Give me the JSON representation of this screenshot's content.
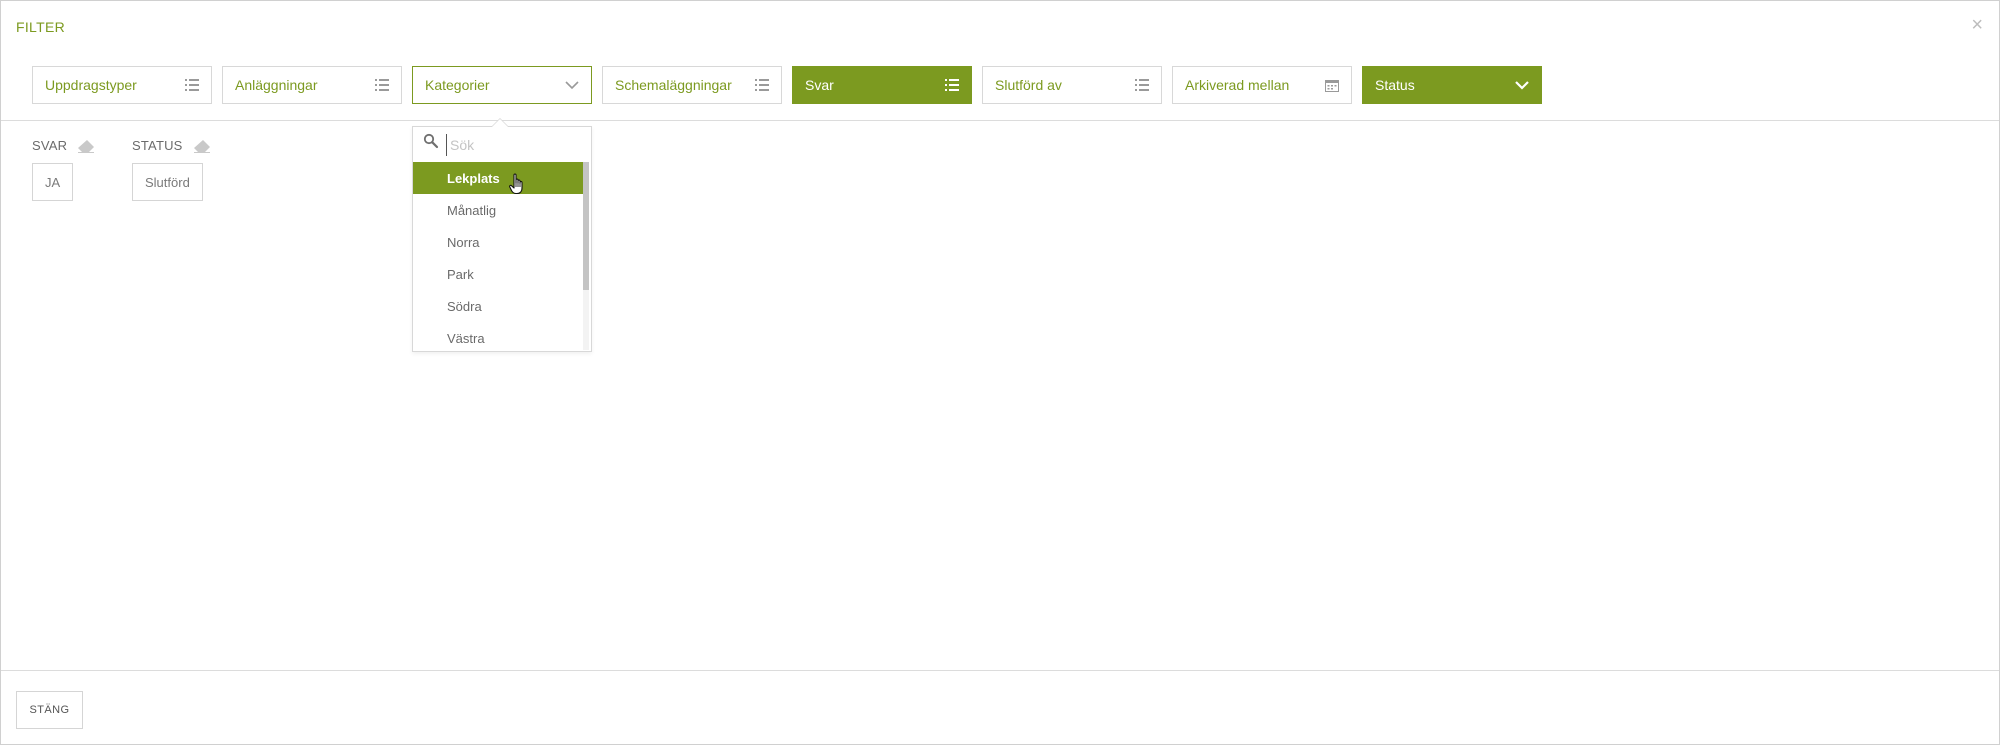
{
  "modal": {
    "title": "FILTER",
    "close_glyph": "×"
  },
  "filters": [
    {
      "label": "Uppdragstyper",
      "icon": "list-icon",
      "state": "default"
    },
    {
      "label": "Anläggningar",
      "icon": "list-icon",
      "state": "default"
    },
    {
      "label": "Kategorier",
      "icon": "chevron-down-icon",
      "state": "open"
    },
    {
      "label": "Schemaläggningar",
      "icon": "list-icon",
      "state": "default"
    },
    {
      "label": "Svar",
      "icon": "list-icon",
      "state": "active"
    },
    {
      "label": "Slutförd av",
      "icon": "list-icon",
      "state": "default"
    },
    {
      "label": "Arkiverad mellan",
      "icon": "calendar-icon",
      "state": "default"
    },
    {
      "label": "Status",
      "icon": "chevron-down-icon",
      "state": "active"
    }
  ],
  "applied": [
    {
      "label": "SVAR",
      "value": "JA"
    },
    {
      "label": "STATUS",
      "value": "Slutförd"
    }
  ],
  "dropdown": {
    "search_placeholder": "Sök",
    "options": [
      "Lekplats",
      "Månatlig",
      "Norra",
      "Park",
      "Södra",
      "Västra"
    ],
    "selected": "Lekplats"
  },
  "footer": {
    "close_label": "STÄNG"
  },
  "colors": {
    "accent": "#7c9a20",
    "border": "#d8d8d8",
    "text": "#6f6f6f"
  }
}
